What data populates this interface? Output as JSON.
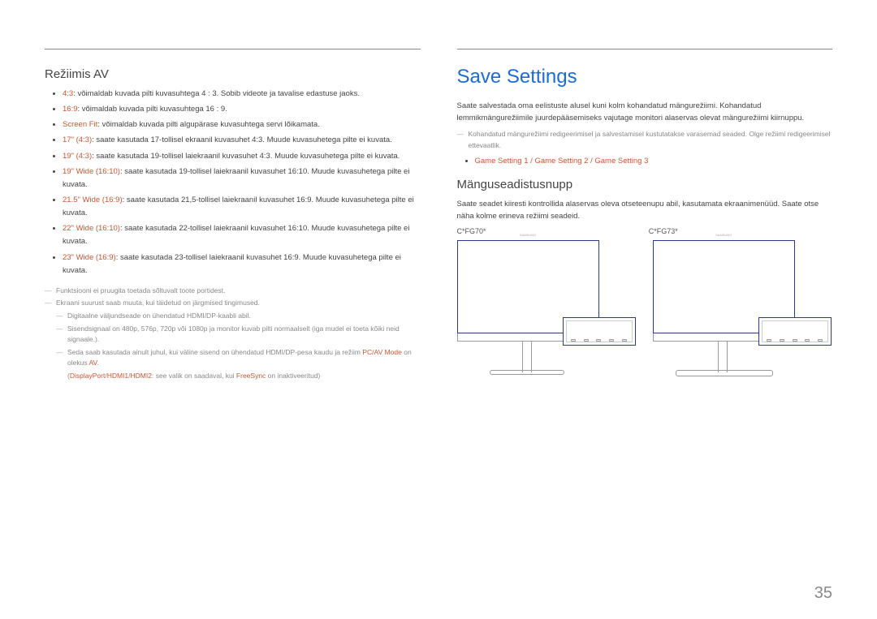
{
  "left": {
    "heading": "Režiimis AV",
    "items": [
      {
        "hl": "4:3",
        "txt": ": võimaldab kuvada pilti kuvasuhtega 4 : 3. Sobib videote ja tavalise edastuse jaoks."
      },
      {
        "hl": "16:9",
        "txt": ": võimaldab kuvada pilti kuvasuhtega 16 : 9."
      },
      {
        "hl": "Screen Fit",
        "txt": ": võimaldab kuvada pilti algupärase kuvasuhtega servi lõikamata."
      },
      {
        "hl": "17\" (4:3)",
        "txt": ": saate kasutada 17-tollisel ekraanil kuvasuhet 4:3. Muude kuvasuhetega pilte ei kuvata."
      },
      {
        "hl": "19\" (4:3)",
        "txt": ": saate kasutada 19-tollisel laiekraanil kuvasuhet 4:3. Muude kuvasuhetega pilte ei kuvata."
      },
      {
        "hl": "19\" Wide (16:10)",
        "txt": ": saate kasutada 19-tollisel laiekraanil kuvasuhet 16:10. Muude kuvasuhetega pilte ei kuvata."
      },
      {
        "hl": "21.5\" Wide (16:9)",
        "txt": ": saate kasutada 21,5-tollisel laiekraanil kuvasuhet 16:9. Muude kuvasuhetega pilte ei kuvata."
      },
      {
        "hl": "22\" Wide (16:10)",
        "txt": ": saate kasutada 22-tollisel laiekraanil kuvasuhet 16:10. Muude kuvasuhetega pilte ei kuvata."
      },
      {
        "hl": "23\" Wide (16:9)",
        "txt": ": saate kasutada 23-tollisel laiekraanil kuvasuhet 16:9. Muude kuvasuhetega pilte ei kuvata."
      }
    ],
    "notes": {
      "n1": "Funktsiooni ei pruugita toetada sõltuvalt toote portidest.",
      "n2": "Ekraani suurust saab muuta, kui täidetud on järgmised tingimused.",
      "n2a": "Digitaalne väljundseade on ühendatud HDMI/DP-kaabli abil.",
      "n2b": "Sisendsignaal on 480p, 576p, 720p või 1080p ja monitor kuvab pilti normaalselt (iga mudel ei toeta kõiki neid signaale.).",
      "n2c_pre": "Seda saab kasutada ainult juhul, kui väline sisend on ühendatud HDMI/DP-pesa kaudu ja režiim ",
      "n2c_hl1": "PC/AV Mode",
      "n2c_mid": " on olekus ",
      "n2c_hl2": "AV",
      "n2c_end": ".",
      "n3_pre": "(",
      "n3_hl1": "DisplayPort",
      "n3_s1": "/",
      "n3_hl2": "HDMI1",
      "n3_s2": "/",
      "n3_hl3": "HDMI2",
      "n3_mid": ": see valik on saadaval, kui ",
      "n3_hl4": "FreeSync",
      "n3_end": " on inaktiveeritud)"
    }
  },
  "right": {
    "title": "Save Settings",
    "para1": "Saate salvestada oma eelistuste alusel kuni kolm kohandatud mängurežiimi. Kohandatud lemmikmängurežiimile juurdepääsemiseks vajutage monitori alaservas olevat mängurežiimi kiirnuppu.",
    "note1": "Kohandatud mängurežiimi redigeerimisel ja salvestamisel kustutatakse varasemad seaded. Olge režiimi redigeerimisel ettevaatlik.",
    "settings": {
      "g1": "Game Setting 1",
      "s1": " / ",
      "g2": "Game Setting 2",
      "s2": " / ",
      "g3": "Game Setting 3"
    },
    "heading2": "Mänguseadistusnupp",
    "para2": "Saate seadet kiiresti kontrollida alaservas oleva otseteenupu abil, kasutamata ekraanimenüüd. Saate otse näha kolme erineva režiimi seadeid.",
    "model1": "C*FG70*",
    "model2": "C*FG73*"
  },
  "page": "35"
}
